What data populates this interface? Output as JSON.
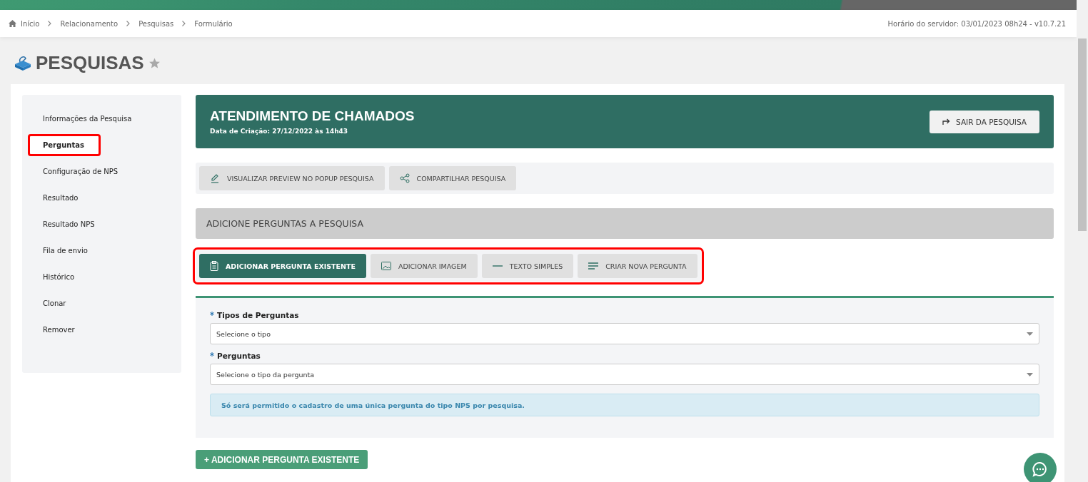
{
  "breadcrumb": [
    {
      "label": "Início",
      "kind": "home"
    },
    {
      "label": "Relacionamento",
      "kind": "plain"
    },
    {
      "label": "Pesquisas",
      "kind": "plain"
    },
    {
      "label": "Formulário",
      "kind": "plain"
    }
  ],
  "server_info": "Horário do servidor: 03/01/2023 08h24 - v10.7.21",
  "page_title": "PESQUISAS",
  "favorite": false,
  "sidebar": {
    "items": [
      {
        "label": "Informações da Pesquisa",
        "selected": false,
        "highlighted": false
      },
      {
        "label": "Perguntas",
        "selected": true,
        "highlighted": true
      },
      {
        "label": "Configuração de NPS",
        "selected": false,
        "highlighted": false
      },
      {
        "label": "Resultado",
        "selected": false,
        "highlighted": false
      },
      {
        "label": "Resultado NPS",
        "selected": false,
        "highlighted": false
      },
      {
        "label": "Fila de envio",
        "selected": false,
        "highlighted": false
      },
      {
        "label": "Histórico",
        "selected": false,
        "highlighted": false
      },
      {
        "label": "Clonar",
        "selected": false,
        "highlighted": false
      },
      {
        "label": "Remover",
        "selected": false,
        "highlighted": false
      }
    ]
  },
  "survey": {
    "title": "ATENDIMENTO DE CHAMADOS",
    "created": "Data de Criação: 27/12/2022 às 14h43",
    "exit_button": "SAIR DA PESQUISA"
  },
  "actions": [
    {
      "label": "VISUALIZAR PREVIEW NO POPUP PESQUISA",
      "kind": "pencil"
    },
    {
      "label": "COMPARTILHAR PESQUISA",
      "kind": "share"
    }
  ],
  "section_title": "ADICIONE PERGUNTAS A PESQUISA",
  "tools": {
    "highlighted": true,
    "items": [
      {
        "label": "ADICIONAR PERGUNTA EXISTENTE",
        "kind": "clipboard",
        "selected": true
      },
      {
        "label": "ADICIONAR IMAGEM",
        "kind": "image",
        "selected": false
      },
      {
        "label": "TEXTO SIMPLES",
        "kind": "line",
        "selected": false
      },
      {
        "label": "CRIAR NOVA PERGUNTA",
        "kind": "lines",
        "selected": false
      }
    ]
  },
  "form": {
    "fields": [
      {
        "label": "Tipos de Perguntas",
        "required": true,
        "placeholder": "Selecione o tipo"
      },
      {
        "label": "Perguntas",
        "required": true,
        "placeholder": "Selecione o tipo da pergunta"
      }
    ],
    "notice": "Só será permitido o cadastro de uma única pergunta do tipo NPS por pesquisa."
  },
  "add_button": "+ ADICIONAR PERGUNTA EXISTENTE"
}
